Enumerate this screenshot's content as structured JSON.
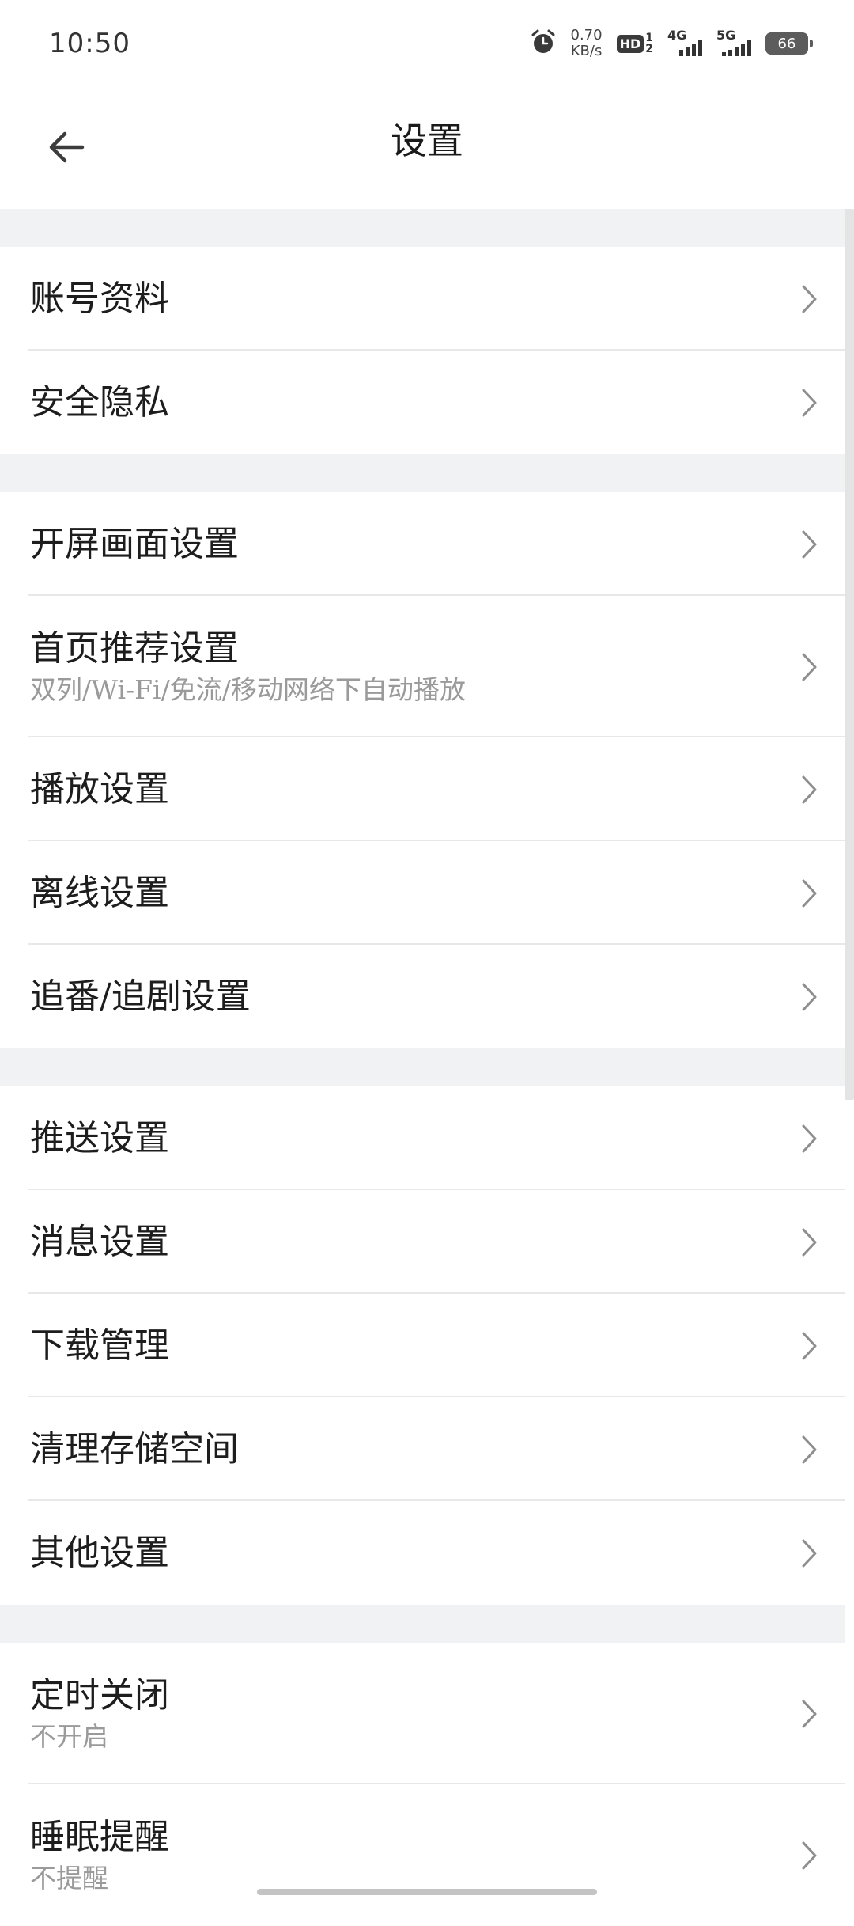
{
  "status_bar": {
    "time": "10:50",
    "net_speed_value": "0.70",
    "net_speed_unit": "KB/s",
    "hd_label": "HD",
    "hd_sub_top": "1",
    "hd_sub_bottom": "2",
    "signal_1_label": "4G",
    "signal_2_label": "5G",
    "battery": "66"
  },
  "header": {
    "title": "设置"
  },
  "groups": [
    {
      "items": [
        {
          "label": "账号资料"
        },
        {
          "label": "安全隐私"
        }
      ]
    },
    {
      "items": [
        {
          "label": "开屏画面设置"
        },
        {
          "label": "首页推荐设置",
          "sub": "双列/Wi-Fi/免流/移动网络下自动播放"
        },
        {
          "label": "播放设置"
        },
        {
          "label": "离线设置"
        },
        {
          "label": "追番/追剧设置"
        }
      ]
    },
    {
      "items": [
        {
          "label": "推送设置"
        },
        {
          "label": "消息设置"
        },
        {
          "label": "下载管理"
        },
        {
          "label": "清理存储空间"
        },
        {
          "label": "其他设置"
        }
      ]
    },
    {
      "items": [
        {
          "label": "定时关闭",
          "sub": "不开启"
        },
        {
          "label": "睡眠提醒",
          "sub": "不提醒"
        }
      ]
    }
  ]
}
